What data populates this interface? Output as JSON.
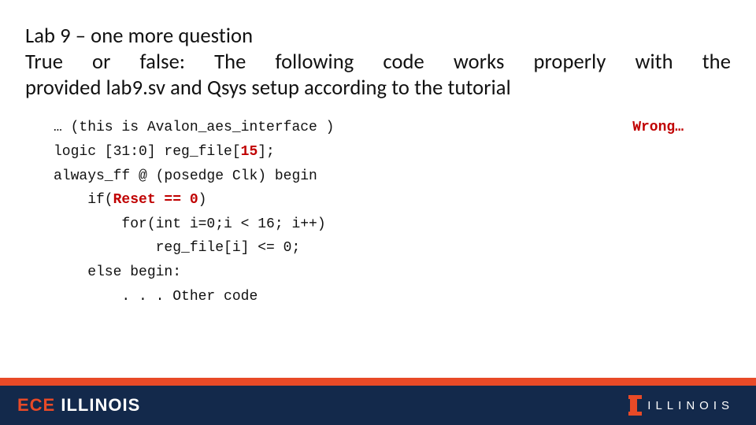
{
  "title": {
    "line1": "Lab 9 – one more question",
    "line2": "True or false: The following code works properly with the",
    "line3": "provided lab9.sv and Qsys setup according to the tutorial"
  },
  "code": {
    "l1a": "… (this is Avalon_aes_interface )",
    "wrong": "Wrong…",
    "l2a": "logic [31:0] reg_file[",
    "l2b": "15",
    "l2c": "];",
    "l3": "always_ff @ (posedge Clk) begin",
    "l4a": "    if(",
    "l4b": "Reset == 0",
    "l4c": ")",
    "l5": "        for(int i=0;i < 16; i++)",
    "l6": "            reg_file[i] <= 0;",
    "l7": "    else begin:",
    "l8": "        . . . Other code"
  },
  "footer": {
    "ece": "ECE",
    "illinois_word": "ILLINOIS",
    "logo_text": "ILLINOIS"
  }
}
